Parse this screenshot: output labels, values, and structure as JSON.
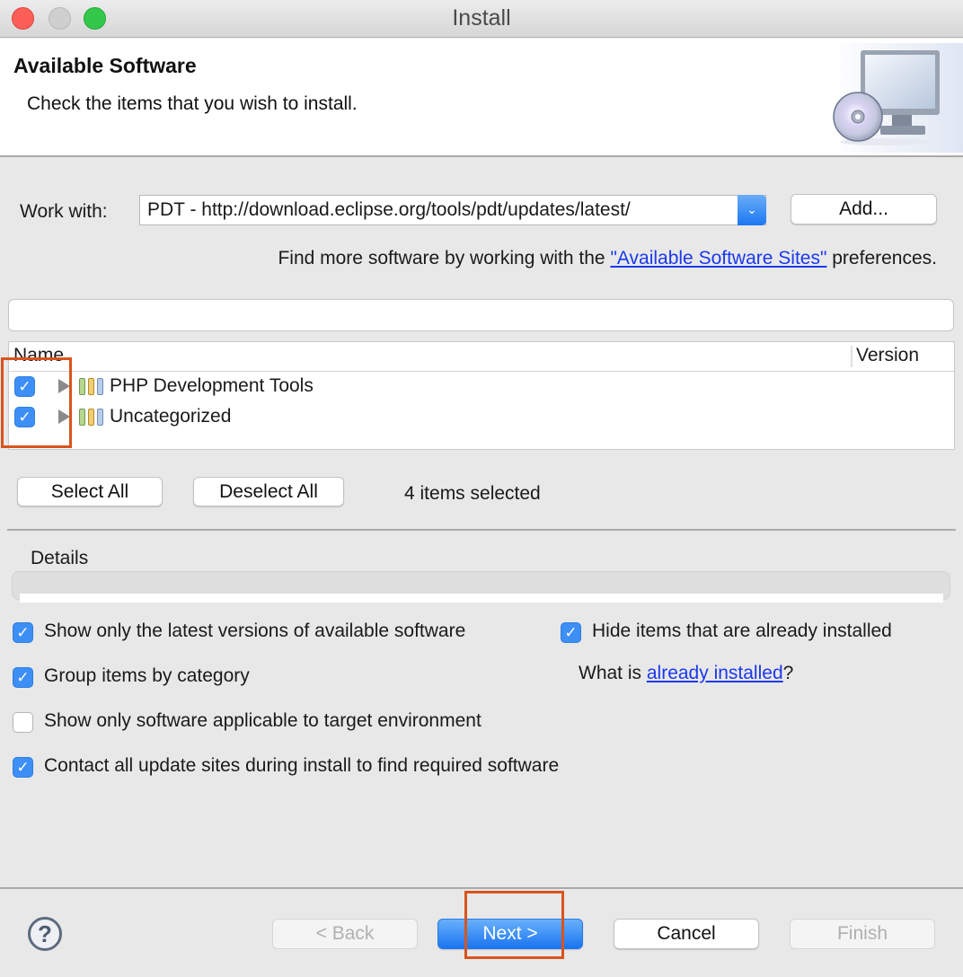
{
  "window": {
    "title": "Install",
    "controls": [
      "close",
      "minimize",
      "maximize"
    ]
  },
  "header": {
    "title": "Available Software",
    "description": "Check the items that you wish to install.",
    "graphic": "install-computer-cd-icon"
  },
  "work_with": {
    "label": "Work with:",
    "value": "PDT - http://download.eclipse.org/tools/pdt/updates/latest/",
    "dropdown_icon": "chevron-down-icon",
    "add_button": "Add..."
  },
  "find_more": {
    "prefix": "Find more software by working with the ",
    "link": "\"Available Software Sites\"",
    "suffix": " preferences."
  },
  "filter": {
    "value": "",
    "placeholder": ""
  },
  "tree": {
    "columns": [
      "Name",
      "Version"
    ],
    "rows": [
      {
        "checked": true,
        "expanded": false,
        "icon": "category-icon",
        "name": "PHP Development Tools",
        "version": ""
      },
      {
        "checked": true,
        "expanded": false,
        "icon": "category-icon",
        "name": "Uncategorized",
        "version": ""
      }
    ]
  },
  "selection": {
    "select_all": "Select All",
    "deselect_all": "Deselect All",
    "count_text": "4 items selected"
  },
  "details": {
    "label": "Details",
    "content": ""
  },
  "options": [
    {
      "label": "Show only the latest versions of available software",
      "checked": true
    },
    {
      "label": "Group items by category",
      "checked": true
    },
    {
      "label": "Show only software applicable to target environment",
      "checked": false
    },
    {
      "label": "Contact all update sites during install to find required software",
      "checked": true
    },
    {
      "label": "Hide items that are already installed",
      "checked": true
    }
  ],
  "what_is": {
    "prefix": "What is ",
    "link": "already installed",
    "suffix": "?"
  },
  "footer": {
    "help_icon": "?",
    "back": "< Back",
    "next": "Next >",
    "cancel": "Cancel",
    "finish": "Finish",
    "back_enabled": false,
    "finish_enabled": false
  },
  "colors": {
    "accent": "#1a74f0",
    "link": "#1a38ef",
    "annotation": "#d9541e",
    "checkbox": "#3d8ff5"
  }
}
